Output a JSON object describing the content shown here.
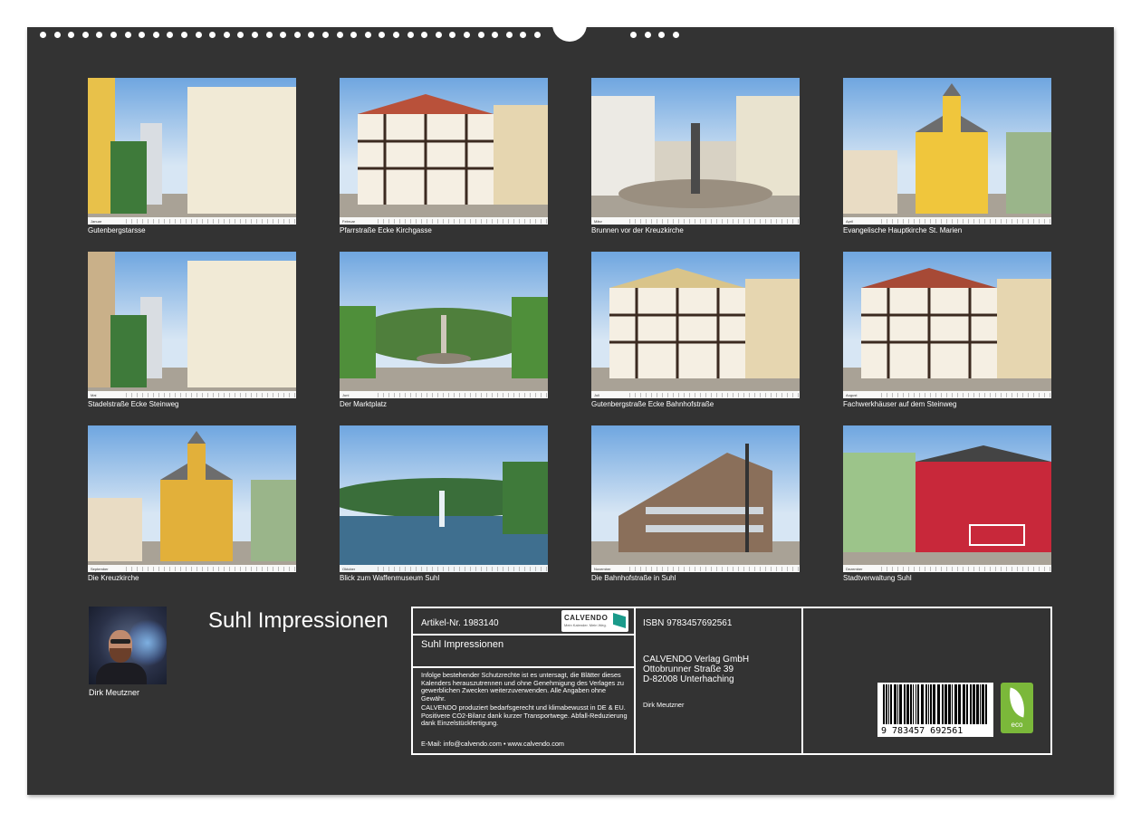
{
  "calendar": {
    "title": "Suhl Impressionen",
    "author": "Dirk Meutzner"
  },
  "tiles": [
    {
      "caption": "Gutenbergstarsse",
      "month": "Januar",
      "scene": "street",
      "accent": "#e8c14a"
    },
    {
      "caption": "Pfarrstraße Ecke Kirchgasse",
      "month": "Februar",
      "scene": "timber",
      "accent": "#b9513a"
    },
    {
      "caption": "Brunnen vor der Kreuzkirche",
      "month": "März",
      "scene": "fountain",
      "accent": "#9a8f80"
    },
    {
      "caption": "Evangelische Hauptkirche St. Marien",
      "month": "April",
      "scene": "church",
      "accent": "#f0c63c"
    },
    {
      "caption": "Stadelstraße Ecke Steinweg",
      "month": "Mai",
      "scene": "street",
      "accent": "#c9b089"
    },
    {
      "caption": "Der Marktplatz",
      "month": "Juni",
      "scene": "square",
      "accent": "#4f8f3a"
    },
    {
      "caption": "Gutenbergstraße Ecke Bahnhofstraße",
      "month": "Juli",
      "scene": "timber",
      "accent": "#d9c48a"
    },
    {
      "caption": "Fachwerkhäuser auf dem Steinweg",
      "month": "August",
      "scene": "timber",
      "accent": "#a74a36"
    },
    {
      "caption": "Die Kreuzkirche",
      "month": "September",
      "scene": "church",
      "accent": "#e2b03a"
    },
    {
      "caption": "Blick zum Waffenmuseum Suhl",
      "month": "Oktober",
      "scene": "lake",
      "accent": "#3f7a3a"
    },
    {
      "caption": "Die Bahnhofstraße in Suhl",
      "month": "November",
      "scene": "modern",
      "accent": "#8a6f5a"
    },
    {
      "caption": "Stadtverwaltung Suhl",
      "month": "Dezember",
      "scene": "townhall",
      "accent": "#c8283a"
    }
  ],
  "info": {
    "article": "Artikel-Nr. 1983140",
    "logo_text": "CALVENDO",
    "logo_subtitle": "Mein Kalender. Mein Weg.",
    "product_title": "Suhl Impressionen",
    "legal_1": "Infolge bestehender Schutzrechte ist es untersagt, die Blätter dieses Kalenders herauszutrennen und ohne Genehmigung des Verlages zu gewerblichen Zwecken weiterzuverwenden. Alle Angaben ohne Gewähr.",
    "legal_2": "CALVENDO produziert bedarfsgerecht und klimabewusst in DE & EU. Positivere CO2-Bilanz dank kurzer Transportwege. Abfall-Reduzierung dank Einzelstückfertigung.",
    "contact": "E-Mail: info@calvendo.com • www.calvendo.com",
    "isbn": "ISBN 9783457692561",
    "publisher_name": "CALVENDO Verlag GmbH",
    "publisher_street": "Ottobrunner Straße 39",
    "publisher_city": "D-82008 Unterhaching",
    "publisher_author": "Dirk Meutzner",
    "barcode_number": "9 783457 692561",
    "eco_label": "eco"
  }
}
